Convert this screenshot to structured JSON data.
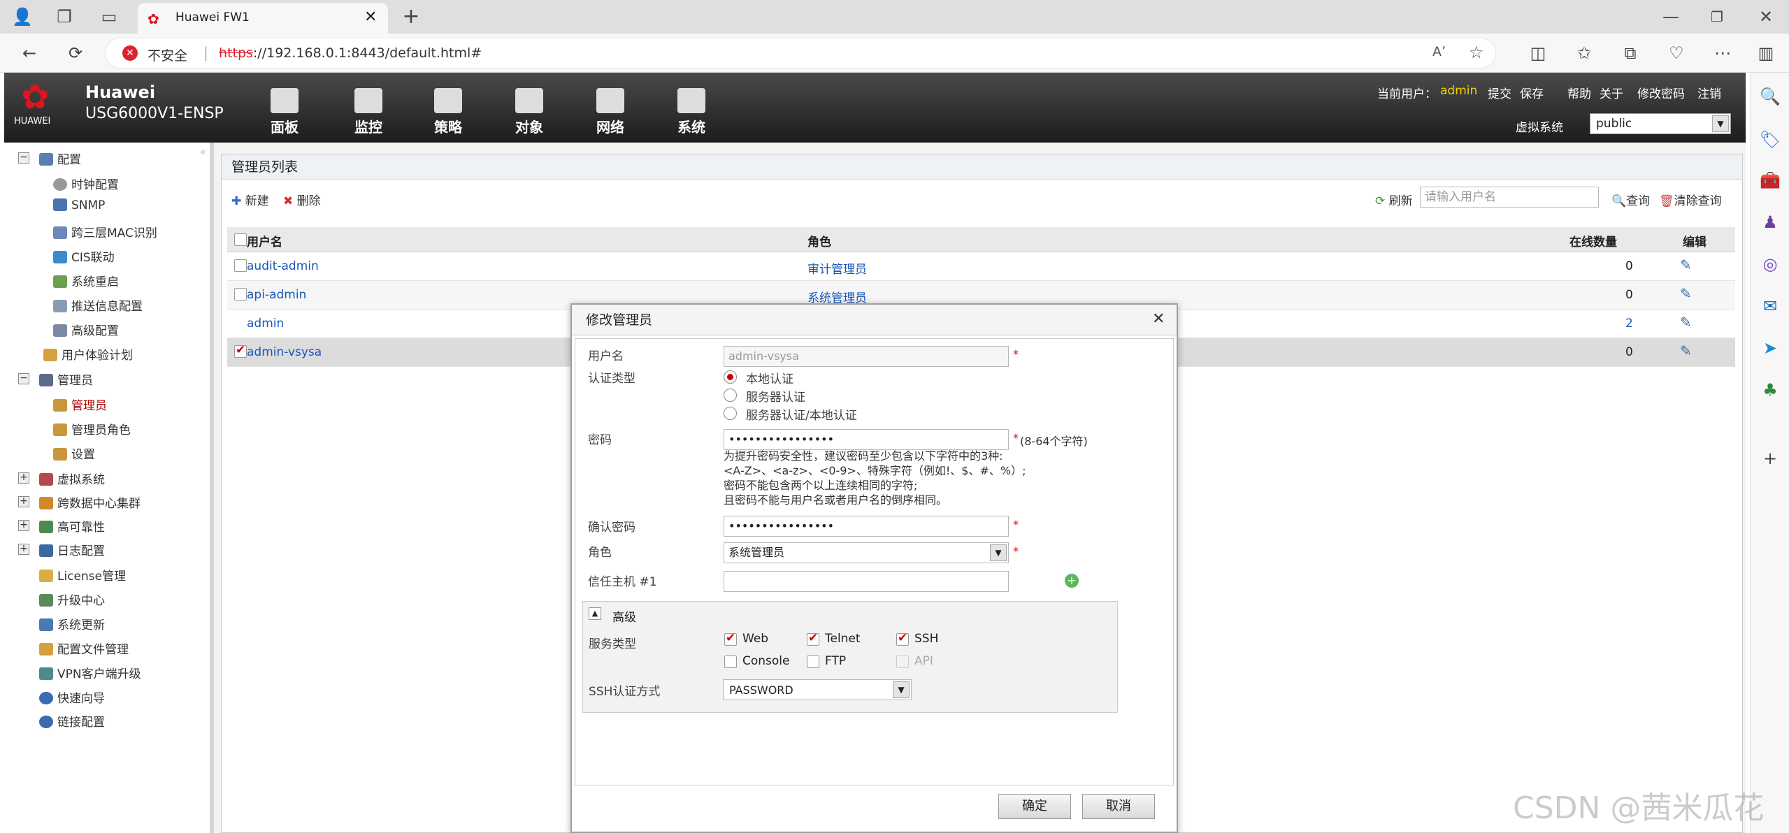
{
  "browser": {
    "tab_title": "Huawei FW1",
    "insecure_label": "不安全",
    "url_scheme": "https",
    "url_rest": "://192.168.0.1:8443/default.html#"
  },
  "app": {
    "brand": "Huawei",
    "logo_text": "HUAWEI",
    "model": "USG6000V1-ENSP",
    "nav": [
      "面板",
      "监控",
      "策略",
      "对象",
      "网络",
      "系统"
    ],
    "user_label": "当前用户：",
    "user_name": "admin",
    "header_links": [
      "提交",
      "保存",
      "帮助",
      "关于",
      "修改密码",
      "注销"
    ],
    "vsys_label": "虚拟系统",
    "vsys_value": "public"
  },
  "sidebar": {
    "items": [
      "配置",
      "时钟配置",
      "SNMP",
      "跨三层MAC识别",
      "CIS联动",
      "系统重启",
      "推送信息配置",
      "高级配置",
      "用户体验计划",
      "管理员",
      "管理员",
      "管理员角色",
      "设置",
      "虚拟系统",
      "跨数据中心集群",
      "高可靠性",
      "日志配置",
      "License管理",
      "升级中心",
      "系统更新",
      "配置文件管理",
      "VPN客户端升级",
      "快速向导",
      "链接配置"
    ]
  },
  "panel": {
    "title": "管理员列表",
    "new_label": "新建",
    "delete_label": "删除",
    "refresh_label": "刷新",
    "search_placeholder": "请输入用户名",
    "query_label": "查询",
    "clear_label": "清除查询",
    "columns": [
      "用户名",
      "角色",
      "在线数量",
      "编辑"
    ],
    "rows": [
      {
        "user": "audit-admin",
        "role": "审计管理员",
        "online": "0"
      },
      {
        "user": "api-admin",
        "role": "系统管理员",
        "online": "0"
      },
      {
        "user": "admin",
        "role": "",
        "online": "2"
      },
      {
        "user": "admin-vsysa",
        "role": "",
        "online": "0"
      }
    ]
  },
  "modal": {
    "title": "修改管理员",
    "username_label": "用户名",
    "username_value": "admin-vsysa",
    "auth_type_label": "认证类型",
    "auth_options": [
      "本地认证",
      "服务器认证",
      "服务器认证/本地认证"
    ],
    "password_label": "密码",
    "password_value": "••••••••••••••••",
    "password_hint_len": "(8-64个字符)",
    "password_hint": [
      "为提升密码安全性，建议密码至少包含以下字符中的3种:",
      "<A-Z>、<a-z>、<0-9>、特殊字符（例如!、$、#、%）;",
      "密码不能包含两个以上连续相同的字符;",
      "且密码不能与用户名或者用户名的倒序相同。"
    ],
    "confirm_label": "确认密码",
    "confirm_value": "••••••••••••••••",
    "role_label": "角色",
    "role_value": "系统管理员",
    "trust_label": "信任主机 #1",
    "advanced_label": "高级",
    "service_label": "服务类型",
    "services": [
      "Web",
      "Telnet",
      "SSH",
      "Console",
      "FTP",
      "API"
    ],
    "ssh_label": "SSH认证方式",
    "ssh_value": "PASSWORD",
    "ok_label": "确定",
    "cancel_label": "取消"
  },
  "watermark": "CSDN @茜米瓜花"
}
